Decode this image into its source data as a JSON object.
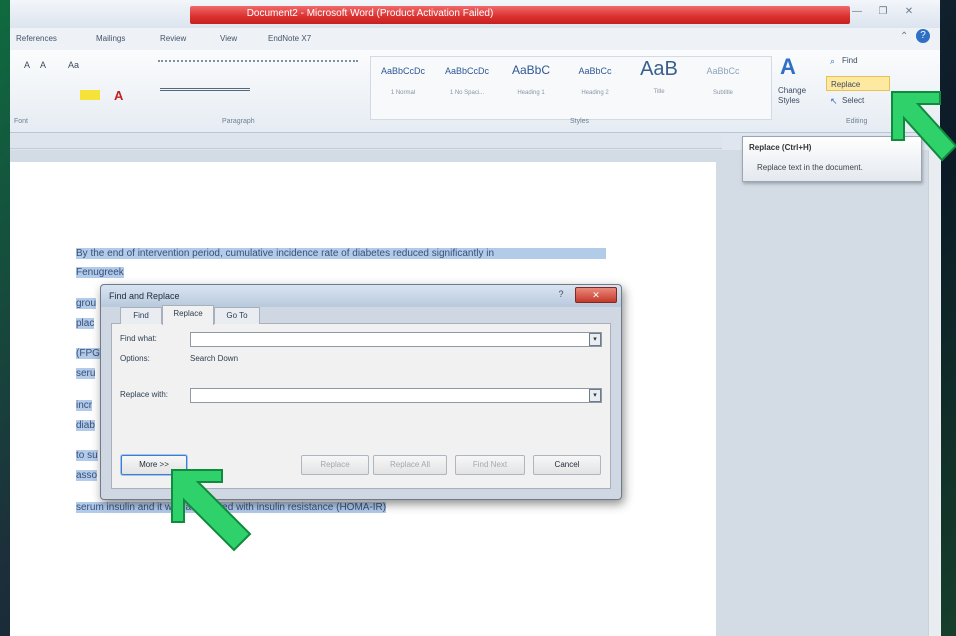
{
  "window": {
    "title": "Document2 - Microsoft Word (Product Activation Failed)"
  },
  "ribbon": {
    "tabs": [
      "References",
      "Mailings",
      "Review",
      "View",
      "EndNote X7"
    ],
    "font_group": {
      "label": "Font",
      "buttons": [
        "A",
        "A",
        "Aa",
        "A"
      ]
    },
    "paragraph_group": {
      "label": "Paragraph"
    },
    "styles_group": {
      "label": "Styles",
      "items": [
        {
          "sample": "AaBbCcDc",
          "name": "1 Normal"
        },
        {
          "sample": "AaBbCcDc",
          "name": "1 No Spaci..."
        },
        {
          "sample": "AaBbC",
          "name": "Heading 1"
        },
        {
          "sample": "AaBbCc",
          "name": "Heading 2"
        },
        {
          "sample": "AaB",
          "name": "Title"
        },
        {
          "sample": "AaBbCc",
          "name": "Subtitle"
        }
      ],
      "change_styles": "Change Styles"
    },
    "editing_group": {
      "label": "Editing",
      "find": "Find",
      "replace": "Replace",
      "select": "Select"
    }
  },
  "tooltip": {
    "title": "Replace (Ctrl+H)",
    "description": "Replace text in the document."
  },
  "document": {
    "lines": [
      "By the end of intervention period, cumulative incidence rate of diabetes reduced significantly in",
      "Fenugreek",
      "grou",
      "plac",
      "(FPG",
      "seru",
      "incr",
      "diab",
      "to su",
      "asso",
      "serum insulin and it was associated with insulin resistance (HOMA-IR)"
    ]
  },
  "dialog": {
    "title": "Find and Replace",
    "tabs": [
      "Find",
      "Replace",
      "Go To"
    ],
    "active_tab": "Replace",
    "find_label": "Find what:",
    "find_value": "",
    "options_label": "Options:",
    "options_value": "Search Down",
    "replace_label": "Replace with:",
    "replace_value": "",
    "buttons": {
      "more": "More >>",
      "replace": "Replace",
      "replace_all": "Replace All",
      "find_next": "Find Next",
      "cancel": "Cancel"
    }
  },
  "colors": {
    "title_bar_accent": "#d92f2f",
    "selection_highlight": "#b2cbe9",
    "arrow_green": "#22c35a"
  }
}
